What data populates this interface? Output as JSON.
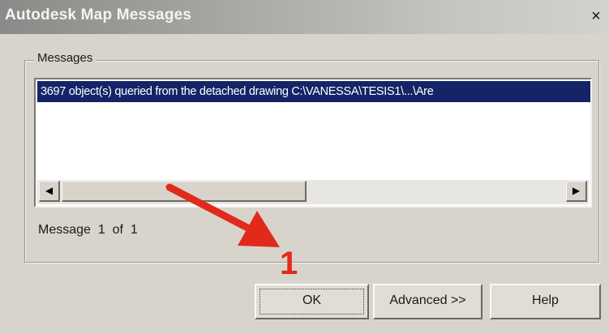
{
  "window": {
    "title": "Autodesk Map Messages",
    "close_glyph": "×"
  },
  "messages": {
    "group_label": "Messages",
    "items": [
      "3697 object(s) queried from the detached drawing C:\\VANESSA\\TESIS1\\...\\Are"
    ],
    "scroll_left_glyph": "◀",
    "scroll_right_glyph": "▶",
    "status": "Message  1  of  1"
  },
  "annotation": {
    "step_number": "1",
    "arrow_color": "#e22a1c"
  },
  "buttons": {
    "ok": "OK",
    "advanced": "Advanced >>",
    "help": "Help"
  },
  "icons": {
    "close": "close-icon",
    "scroll_left": "left-arrow-icon",
    "scroll_right": "right-arrow-icon"
  },
  "colors": {
    "selection": "#142467",
    "dialog_bg": "#d8d4cc"
  }
}
